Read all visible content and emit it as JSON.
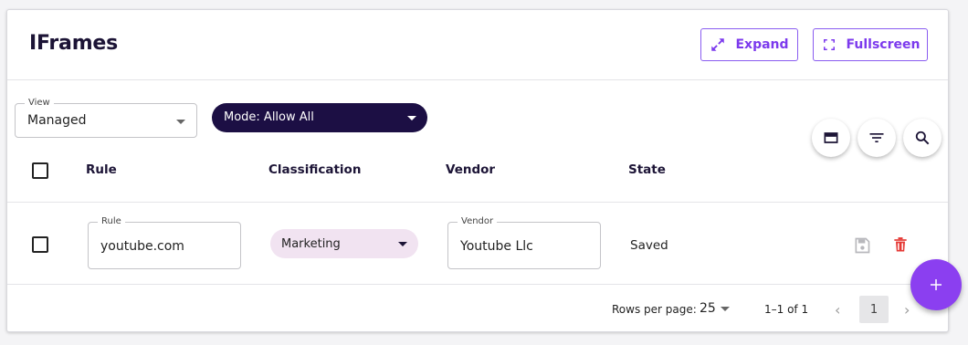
{
  "header": {
    "title": "IFrames",
    "expand_label": "Expand",
    "fullscreen_label": "Fullscreen"
  },
  "toolbar": {
    "view_label": "View",
    "view_value": "Managed",
    "mode_value": "Mode: Allow All"
  },
  "table": {
    "columns": [
      "Rule",
      "Classification",
      "Vendor",
      "State"
    ],
    "rows": [
      {
        "rule_label": "Rule",
        "rule": "youtube.com",
        "classification": "Marketing",
        "vendor_label": "Vendor",
        "vendor": "Youtube Llc",
        "state": "Saved"
      }
    ]
  },
  "pagination": {
    "rows_per_page_label": "Rows per page:",
    "rows_per_page": "25",
    "range": "1–1 of 1",
    "current_page": "1"
  },
  "icons": {
    "expand": "expand-icon",
    "fullscreen": "fullscreen-icon",
    "columns": "view-columns-icon",
    "filter": "filter-icon",
    "search": "search-icon",
    "save": "save-icon",
    "delete": "delete-icon",
    "add": "add-icon"
  },
  "colors": {
    "accent": "#7c3aed",
    "dark": "#1c0f44",
    "fab": "#8b3ff0",
    "delete": "#e53935",
    "classification_bg": "#f1e3f1"
  }
}
